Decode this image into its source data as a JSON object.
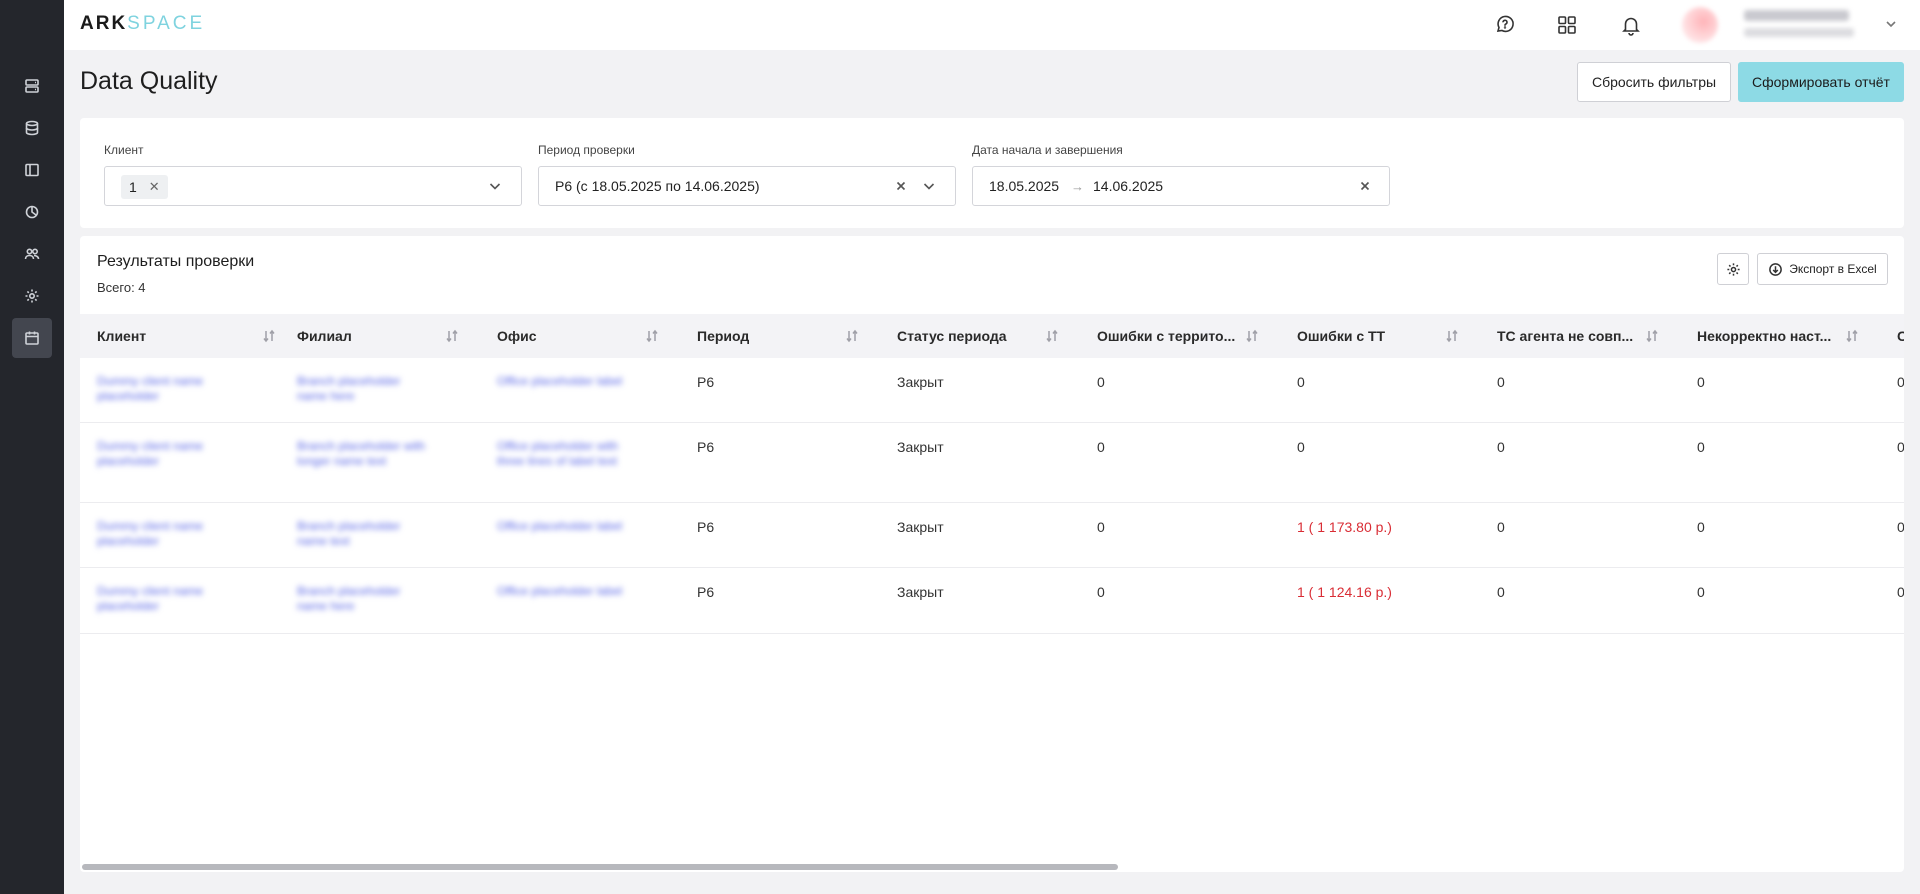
{
  "app": {
    "logo_main": "ARK",
    "logo_accent": "SPACE",
    "page_title": "Data Quality"
  },
  "sidebar": {
    "items": [
      {
        "name": "sidebar-item-servers",
        "icon": "server-icon",
        "active": false
      },
      {
        "name": "sidebar-item-database",
        "icon": "database-icon",
        "active": false
      },
      {
        "name": "sidebar-item-layout",
        "icon": "layout-icon",
        "active": false
      },
      {
        "name": "sidebar-item-reports",
        "icon": "pie-chart-icon",
        "active": false
      },
      {
        "name": "sidebar-item-users",
        "icon": "users-icon",
        "active": false
      },
      {
        "name": "sidebar-item-settings",
        "icon": "gear-icon",
        "active": false
      },
      {
        "name": "sidebar-item-calendar",
        "icon": "calendar-icon",
        "active": true
      }
    ]
  },
  "header": {
    "icons": [
      "chat-question-icon",
      "apps-grid-icon",
      "bell-icon"
    ]
  },
  "actions": {
    "reset_label": "Сбросить фильтры",
    "report_label": "Сформировать отчёт"
  },
  "filters": {
    "client": {
      "label": "Клиент",
      "tag": "1"
    },
    "period": {
      "label": "Период проверки",
      "value": "P6 (с 18.05.2025 по 14.06.2025)"
    },
    "dates": {
      "label": "Дата начала и завершения",
      "start": "18.05.2025",
      "end": "14.06.2025"
    }
  },
  "results": {
    "title": "Результаты проверки",
    "count": "Всего: 4",
    "export_label": "Экспорт в Excel",
    "columns": [
      "Клиент",
      "Филиал",
      "Офис",
      "Период",
      "Статус периода",
      "Ошибки с террито...",
      "Ошибки с ТТ",
      "ТС агента не совп...",
      "Некорректно наст...",
      "С"
    ],
    "rows": [
      {
        "period": "P6",
        "status": "Закрыт",
        "terr_errors": "0",
        "tt_errors": "0",
        "tt_error_flag": false,
        "agent_mismatch": "0",
        "incorrect": "0",
        "extra": "0"
      },
      {
        "period": "P6",
        "status": "Закрыт",
        "terr_errors": "0",
        "tt_errors": "0",
        "tt_error_flag": false,
        "agent_mismatch": "0",
        "incorrect": "0",
        "extra": "0"
      },
      {
        "period": "P6",
        "status": "Закрыт",
        "terr_errors": "0",
        "tt_errors": "1 ( 1 173.80 р.)",
        "tt_error_flag": true,
        "agent_mismatch": "0",
        "incorrect": "0",
        "extra": "0"
      },
      {
        "period": "P6",
        "status": "Закрыт",
        "terr_errors": "0",
        "tt_errors": "1 ( 1 124.16 р.)",
        "tt_error_flag": true,
        "agent_mismatch": "0",
        "incorrect": "0",
        "extra": "0"
      }
    ]
  },
  "colors": {
    "accent": "#8ddae5",
    "sidebar_bg": "#24262c",
    "error_text": "#d92d35",
    "link": "#5865e6"
  }
}
